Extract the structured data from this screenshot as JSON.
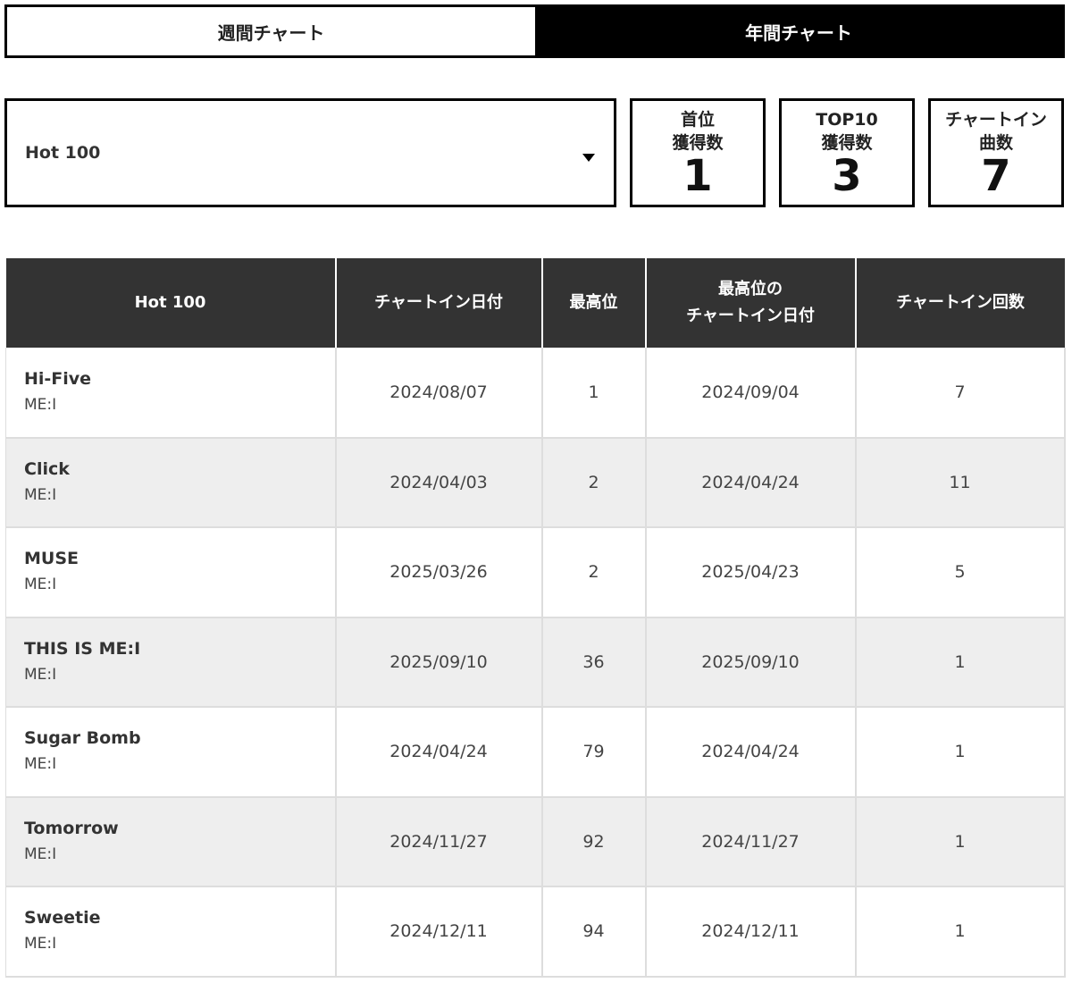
{
  "tabs": [
    {
      "label": "週間チャート",
      "active": false
    },
    {
      "label": "年間チャート",
      "active": true
    }
  ],
  "chart_select": {
    "selected": "Hot 100"
  },
  "stats": [
    {
      "label": "首位\n獲得数",
      "value": "1"
    },
    {
      "label": "TOP10\n獲得数",
      "value": "3"
    },
    {
      "label": "チャートイン\n曲数",
      "value": "7"
    }
  ],
  "table": {
    "headers": [
      "Hot 100",
      "チャートイン日付",
      "最高位",
      "最高位の\nチャートイン日付",
      "チャートイン回数"
    ],
    "rows": [
      {
        "title": "Hi-Five",
        "artist": "ME:I",
        "chart_in_date": "2024/08/07",
        "peak": "1",
        "peak_date": "2024/09/04",
        "weeks": "7"
      },
      {
        "title": "Click",
        "artist": "ME:I",
        "chart_in_date": "2024/04/03",
        "peak": "2",
        "peak_date": "2024/04/24",
        "weeks": "11"
      },
      {
        "title": "MUSE",
        "artist": "ME:I",
        "chart_in_date": "2025/03/26",
        "peak": "2",
        "peak_date": "2025/04/23",
        "weeks": "5"
      },
      {
        "title": "THIS IS ME:I",
        "artist": "ME:I",
        "chart_in_date": "2025/09/10",
        "peak": "36",
        "peak_date": "2025/09/10",
        "weeks": "1"
      },
      {
        "title": "Sugar Bomb",
        "artist": "ME:I",
        "chart_in_date": "2024/04/24",
        "peak": "79",
        "peak_date": "2024/04/24",
        "weeks": "1"
      },
      {
        "title": "Tomorrow",
        "artist": "ME:I",
        "chart_in_date": "2024/11/27",
        "peak": "92",
        "peak_date": "2024/11/27",
        "weeks": "1"
      },
      {
        "title": "Sweetie",
        "artist": "ME:I",
        "chart_in_date": "2024/12/11",
        "peak": "94",
        "peak_date": "2024/12/11",
        "weeks": "1"
      }
    ]
  },
  "colors": {
    "header_bg": "#333333",
    "active_tab_bg": "#000000",
    "stripe_bg": "#eeeeee",
    "border": "#000000"
  },
  "icons": {
    "select_caret": "caret-down-icon"
  }
}
